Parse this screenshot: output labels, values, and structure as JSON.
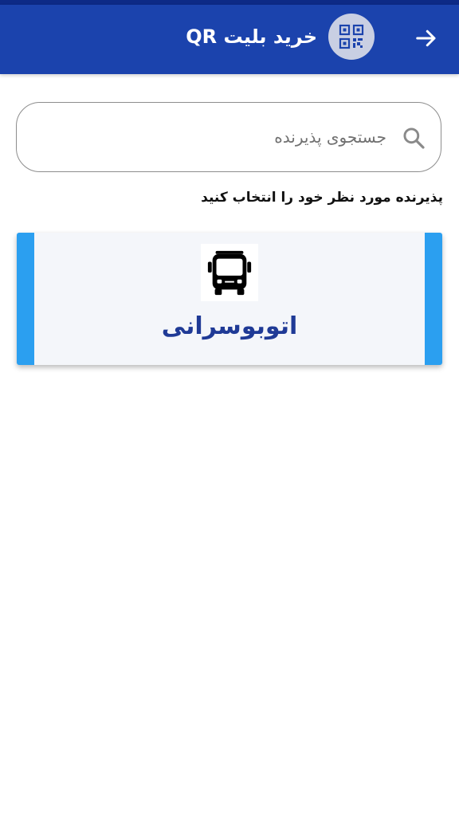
{
  "header": {
    "title": "خرید بلیت QR",
    "back_icon": "arrow-right-icon",
    "qr_icon": "qr-code-icon",
    "bar_color": "#1b43ad"
  },
  "search": {
    "placeholder": "جستجوی پذیرنده",
    "value": "",
    "icon": "search-icon"
  },
  "instruction": "پذیرنده مورد نظر خود را انتخاب کنید",
  "merchants": [
    {
      "label": "اتوبوسرانی",
      "icon": "bus-icon",
      "accent_color": "#2b9ff0"
    }
  ]
}
